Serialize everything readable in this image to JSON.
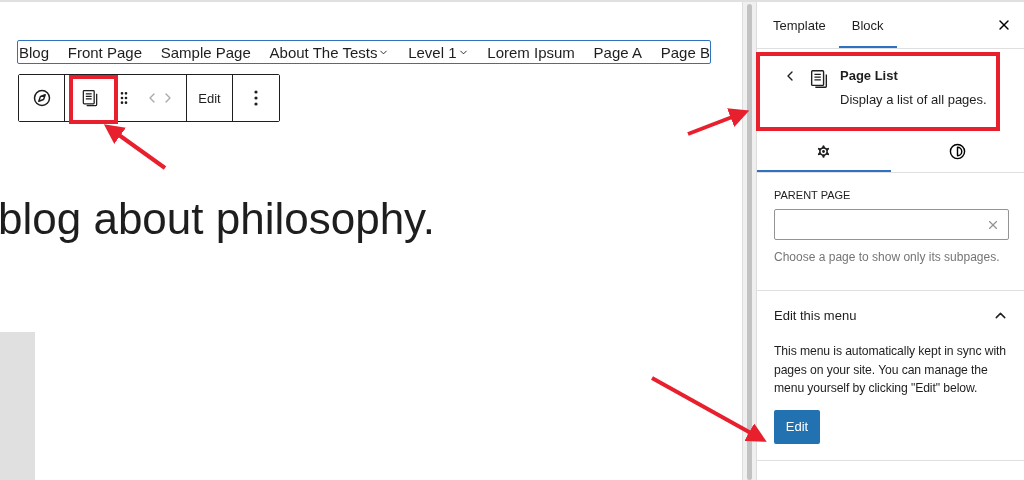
{
  "nav": {
    "items": [
      {
        "label": "Blog",
        "has_submenu": false
      },
      {
        "label": "Front Page",
        "has_submenu": false
      },
      {
        "label": "Sample Page",
        "has_submenu": false
      },
      {
        "label": "About The Tests",
        "has_submenu": true
      },
      {
        "label": "Level 1",
        "has_submenu": true
      },
      {
        "label": "Lorem Ipsum",
        "has_submenu": false
      },
      {
        "label": "Page A",
        "has_submenu": false
      },
      {
        "label": "Page B",
        "has_submenu": false
      }
    ]
  },
  "toolbar": {
    "edit_label": "Edit"
  },
  "heading": "blog about philosophy.",
  "sidebar": {
    "tabs": [
      {
        "label": "Template",
        "selected": false
      },
      {
        "label": "Block",
        "selected": true
      }
    ],
    "block": {
      "title": "Page List",
      "description": "Display a list of all pages."
    },
    "subtabs": [
      {
        "kind": "settings",
        "selected": true
      },
      {
        "kind": "styles",
        "selected": false
      }
    ],
    "parent_page": {
      "label": "PARENT PAGE",
      "help": "Choose a page to show only its subpages."
    },
    "panel": {
      "title": "Edit this menu",
      "expanded": true,
      "text": "This menu is automatically kept in sync with pages on your site. You can manage the menu yourself by clicking \"Edit\" below.",
      "button": "Edit"
    }
  }
}
